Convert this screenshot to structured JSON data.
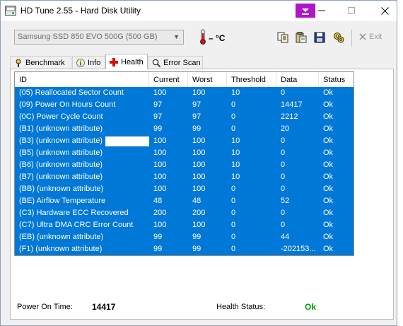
{
  "window": {
    "title": "HD Tune 2.55 - Hard Disk Utility"
  },
  "toolbar": {
    "drive": "Samsung SSD 850 EVO 500G (500 GB)",
    "temperature": "– °C",
    "exit_label": "Exit"
  },
  "tabs": [
    {
      "label": "Benchmark"
    },
    {
      "label": "Info"
    },
    {
      "label": "Health"
    },
    {
      "label": "Error Scan"
    }
  ],
  "health_table": {
    "columns": [
      "ID",
      "Current",
      "Worst",
      "Threshold",
      "Data",
      "Status"
    ],
    "rows": [
      [
        "(05) Reallocated Sector Count",
        "100",
        "100",
        "10",
        "0",
        "Ok"
      ],
      [
        "(09) Power On Hours Count",
        "97",
        "97",
        "0",
        "14417",
        "Ok"
      ],
      [
        "(0C) Power Cycle Count",
        "97",
        "97",
        "0",
        "2212",
        "Ok"
      ],
      [
        "(B1) (unknown attribute)",
        "99",
        "99",
        "0",
        "20",
        "Ok"
      ],
      [
        "(B3) (unknown attribute)",
        "100",
        "100",
        "10",
        "0",
        "Ok"
      ],
      [
        "(B5) (unknown attribute)",
        "100",
        "100",
        "10",
        "0",
        "Ok"
      ],
      [
        "(B6) (unknown attribute)",
        "100",
        "100",
        "10",
        "0",
        "Ok"
      ],
      [
        "(B7) (unknown attribute)",
        "100",
        "100",
        "10",
        "0",
        "Ok"
      ],
      [
        "(BB) (unknown attribute)",
        "100",
        "100",
        "0",
        "0",
        "Ok"
      ],
      [
        "(BE) Airflow Temperature",
        "48",
        "48",
        "0",
        "52",
        "Ok"
      ],
      [
        "(C3) Hardware ECC Recovered",
        "200",
        "200",
        "0",
        "0",
        "Ok"
      ],
      [
        "(C7) Ultra DMA CRC Error Count",
        "100",
        "100",
        "0",
        "0",
        "Ok"
      ],
      [
        "(EB) (unknown attribute)",
        "99",
        "99",
        "0",
        "44",
        "Ok"
      ],
      [
        "(F1) (unknown attribute)",
        "99",
        "99",
        "0",
        "-202153...",
        "Ok"
      ]
    ]
  },
  "status": {
    "power_on_label": "Power On Time:",
    "power_on_value": "14417",
    "health_label": "Health Status:",
    "health_value": "Ok",
    "health_color": "#00a000"
  },
  "colors": {
    "selection": "#0078d7",
    "download_accent": "#b015c8"
  }
}
